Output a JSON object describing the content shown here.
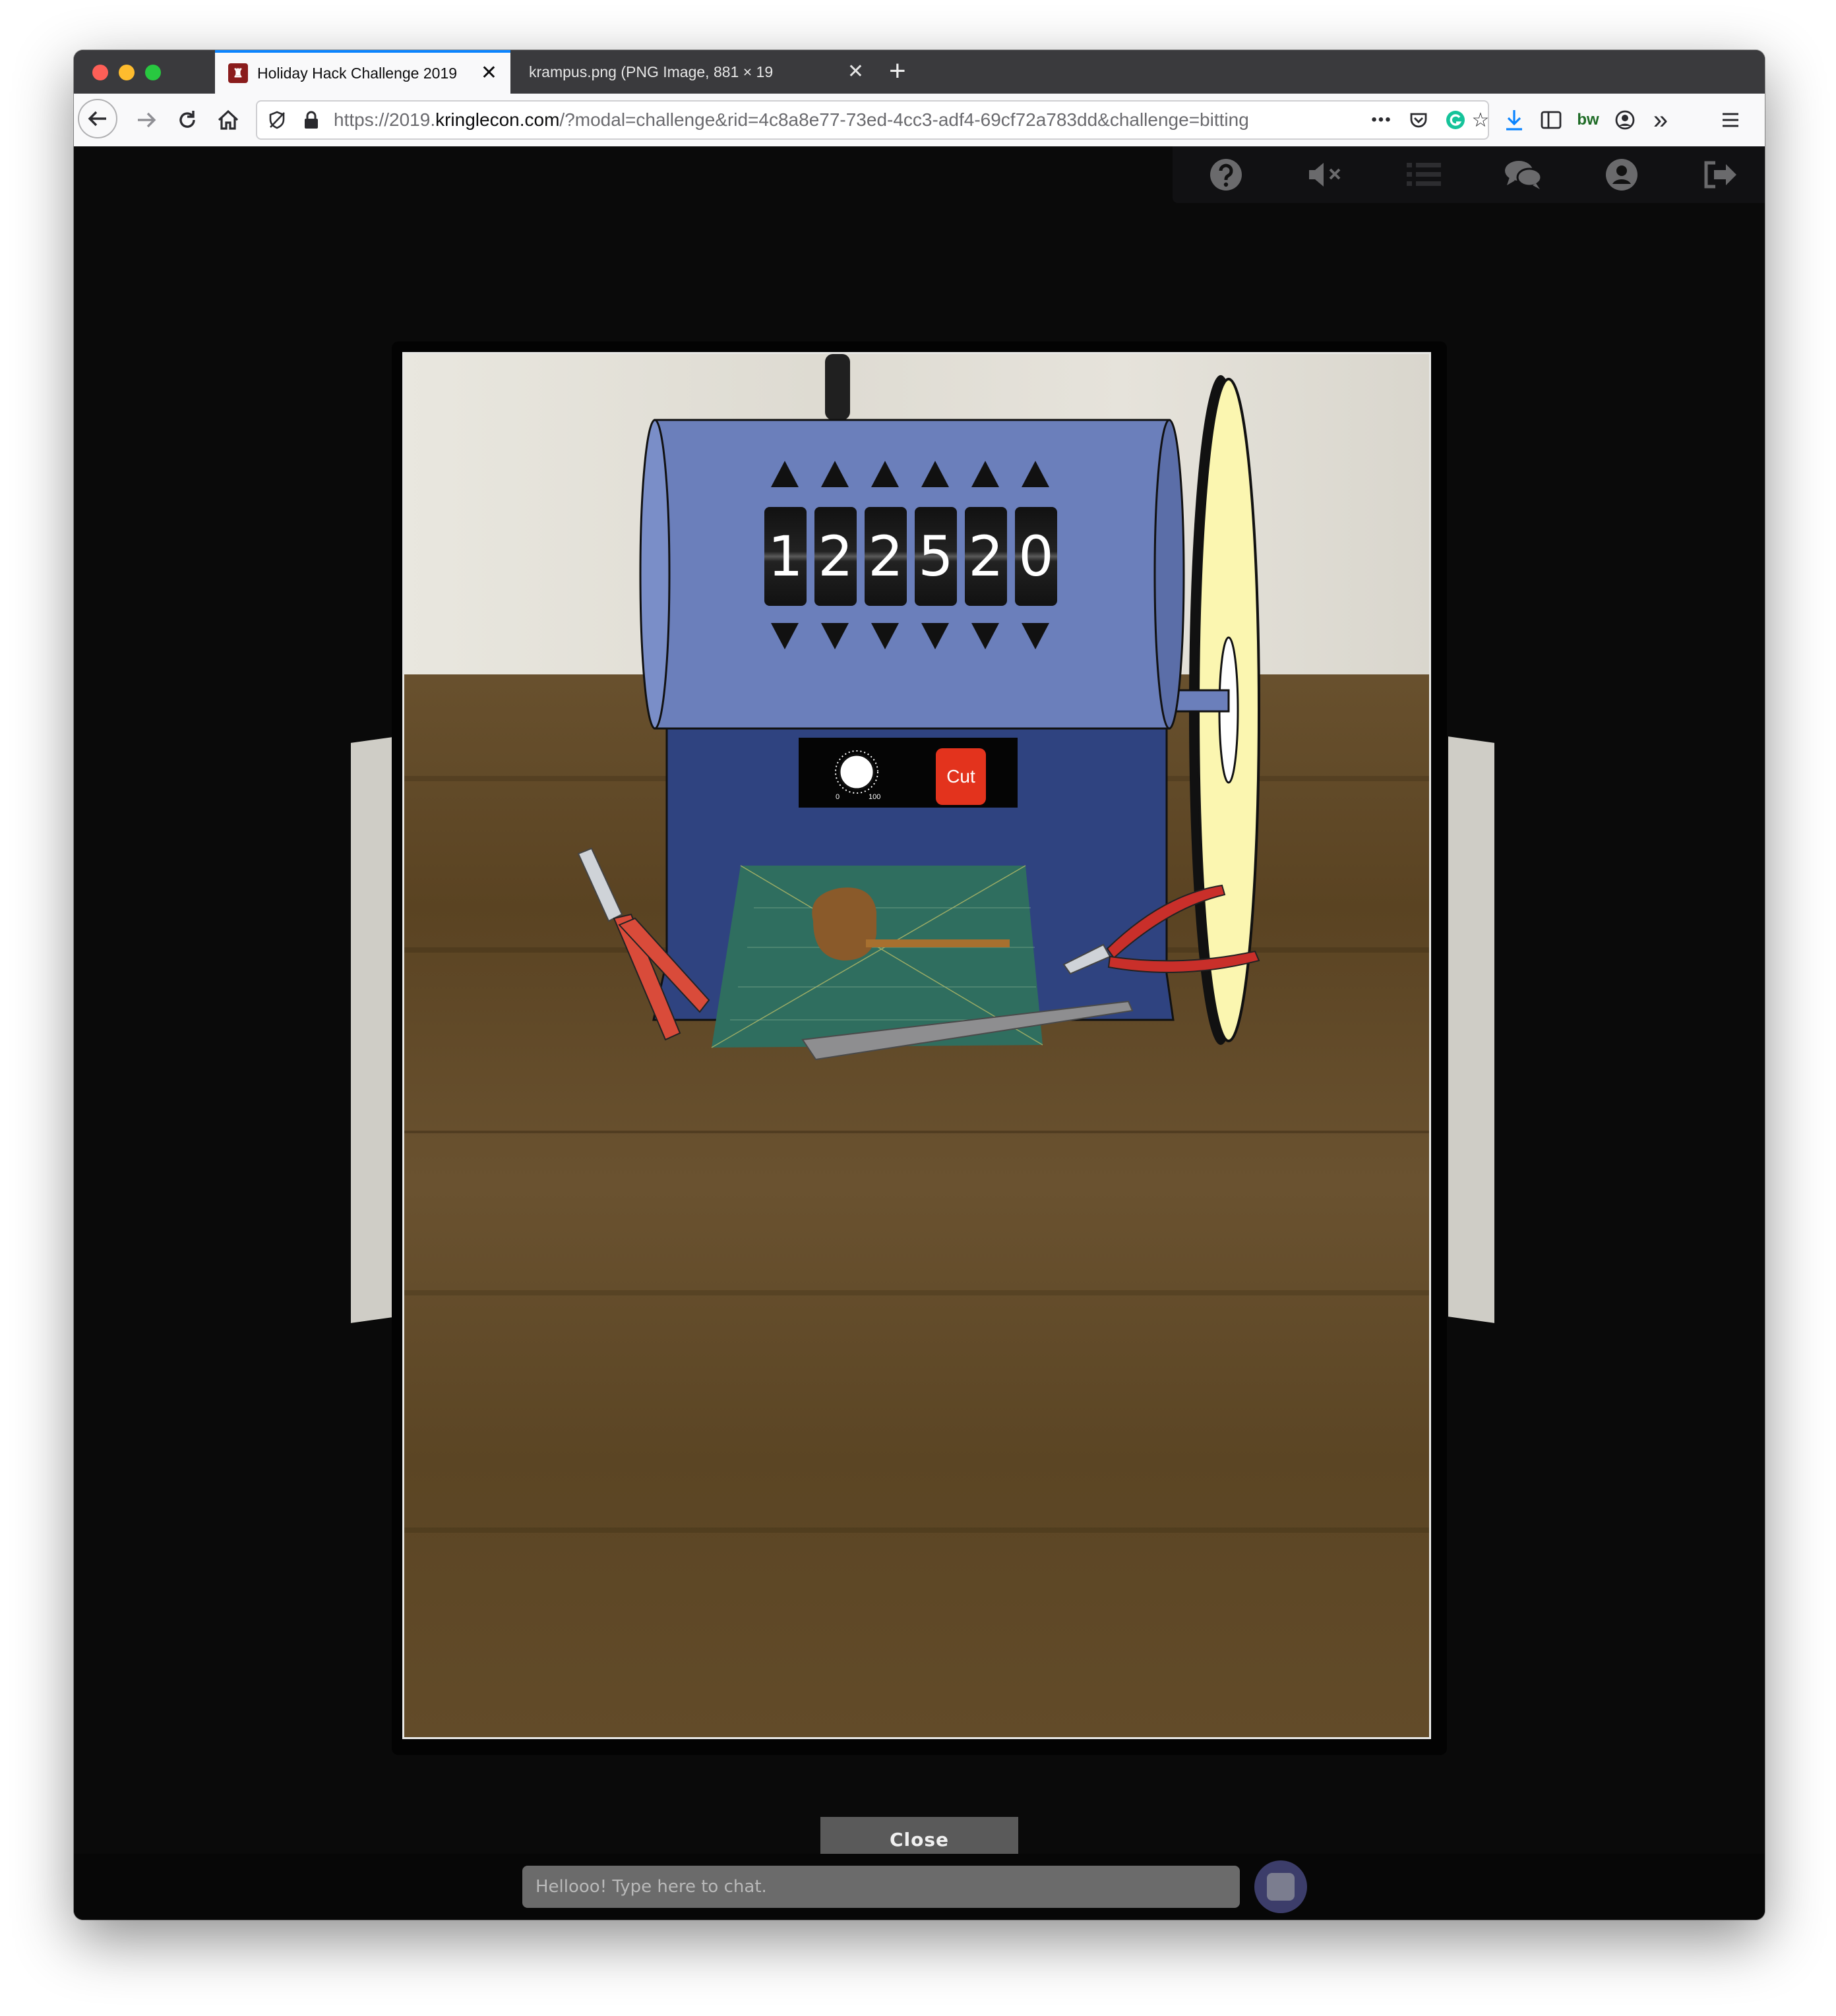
{
  "browser": {
    "tabs": [
      {
        "title": "Holiday Hack Challenge 2019",
        "active": true
      },
      {
        "title": "krampus.png (PNG Image, 881 × 19",
        "active": false
      }
    ],
    "url": {
      "prefix": "https://2019.",
      "domain": "kringlecon.com",
      "path": "/?modal=challenge&rid=4c8a8e77-73ed-4cc3-adf4-69cf72a783dd&challenge=bitting"
    },
    "toolbar_badge": "bw",
    "more_dots": "•••"
  },
  "game_toolbar": {
    "icons": [
      "help-icon",
      "mute-icon",
      "list-icon",
      "chat-icon",
      "account-icon",
      "logout-icon"
    ]
  },
  "key_cutter": {
    "digits": [
      "1",
      "2",
      "2",
      "5",
      "2",
      "0"
    ],
    "cut_label": "Cut",
    "dial_min": "0",
    "dial_max": "100"
  },
  "modal": {
    "close_label": "Close"
  },
  "chat": {
    "placeholder": "Hellooo! Type here to chat."
  },
  "colors": {
    "machine_body": "#6b7fbb",
    "machine_base": "#2f4380",
    "cut_button": "#e3331d",
    "grinding_wheel": "#fbf6b0",
    "cutting_mat": "#2f6e5f"
  }
}
